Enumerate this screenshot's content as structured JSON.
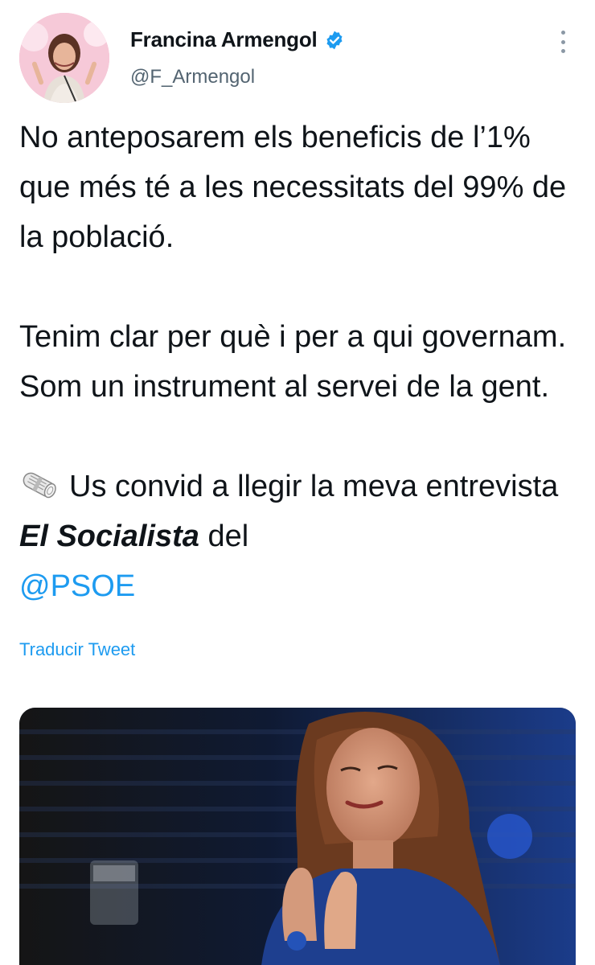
{
  "author": {
    "display_name": "Francina Armengol",
    "handle": "@F_Armengol",
    "verified": true,
    "avatar_icon": "profile-photo"
  },
  "tweet": {
    "paragraph_1": "No anteposarem els beneficis de l’1% que més té a les necessitats del 99% de la població.",
    "paragraph_2": "Tenim clar per què i per a qui governam. Som un instrument al servei de la gent.",
    "paragraph_3": {
      "emoji": "rolled-newspaper",
      "text_before": "Us convid a llegir la meva entrevista ",
      "bold_italic": "El Socialista",
      "text_after": " del",
      "mention": "@PSOE"
    }
  },
  "actions": {
    "translate_label": "Traducir Tweet",
    "more_icon": "more-vertical-icon"
  },
  "colors": {
    "accent": "#1d9bf0",
    "handle": "#536471",
    "text": "#0f1419"
  }
}
